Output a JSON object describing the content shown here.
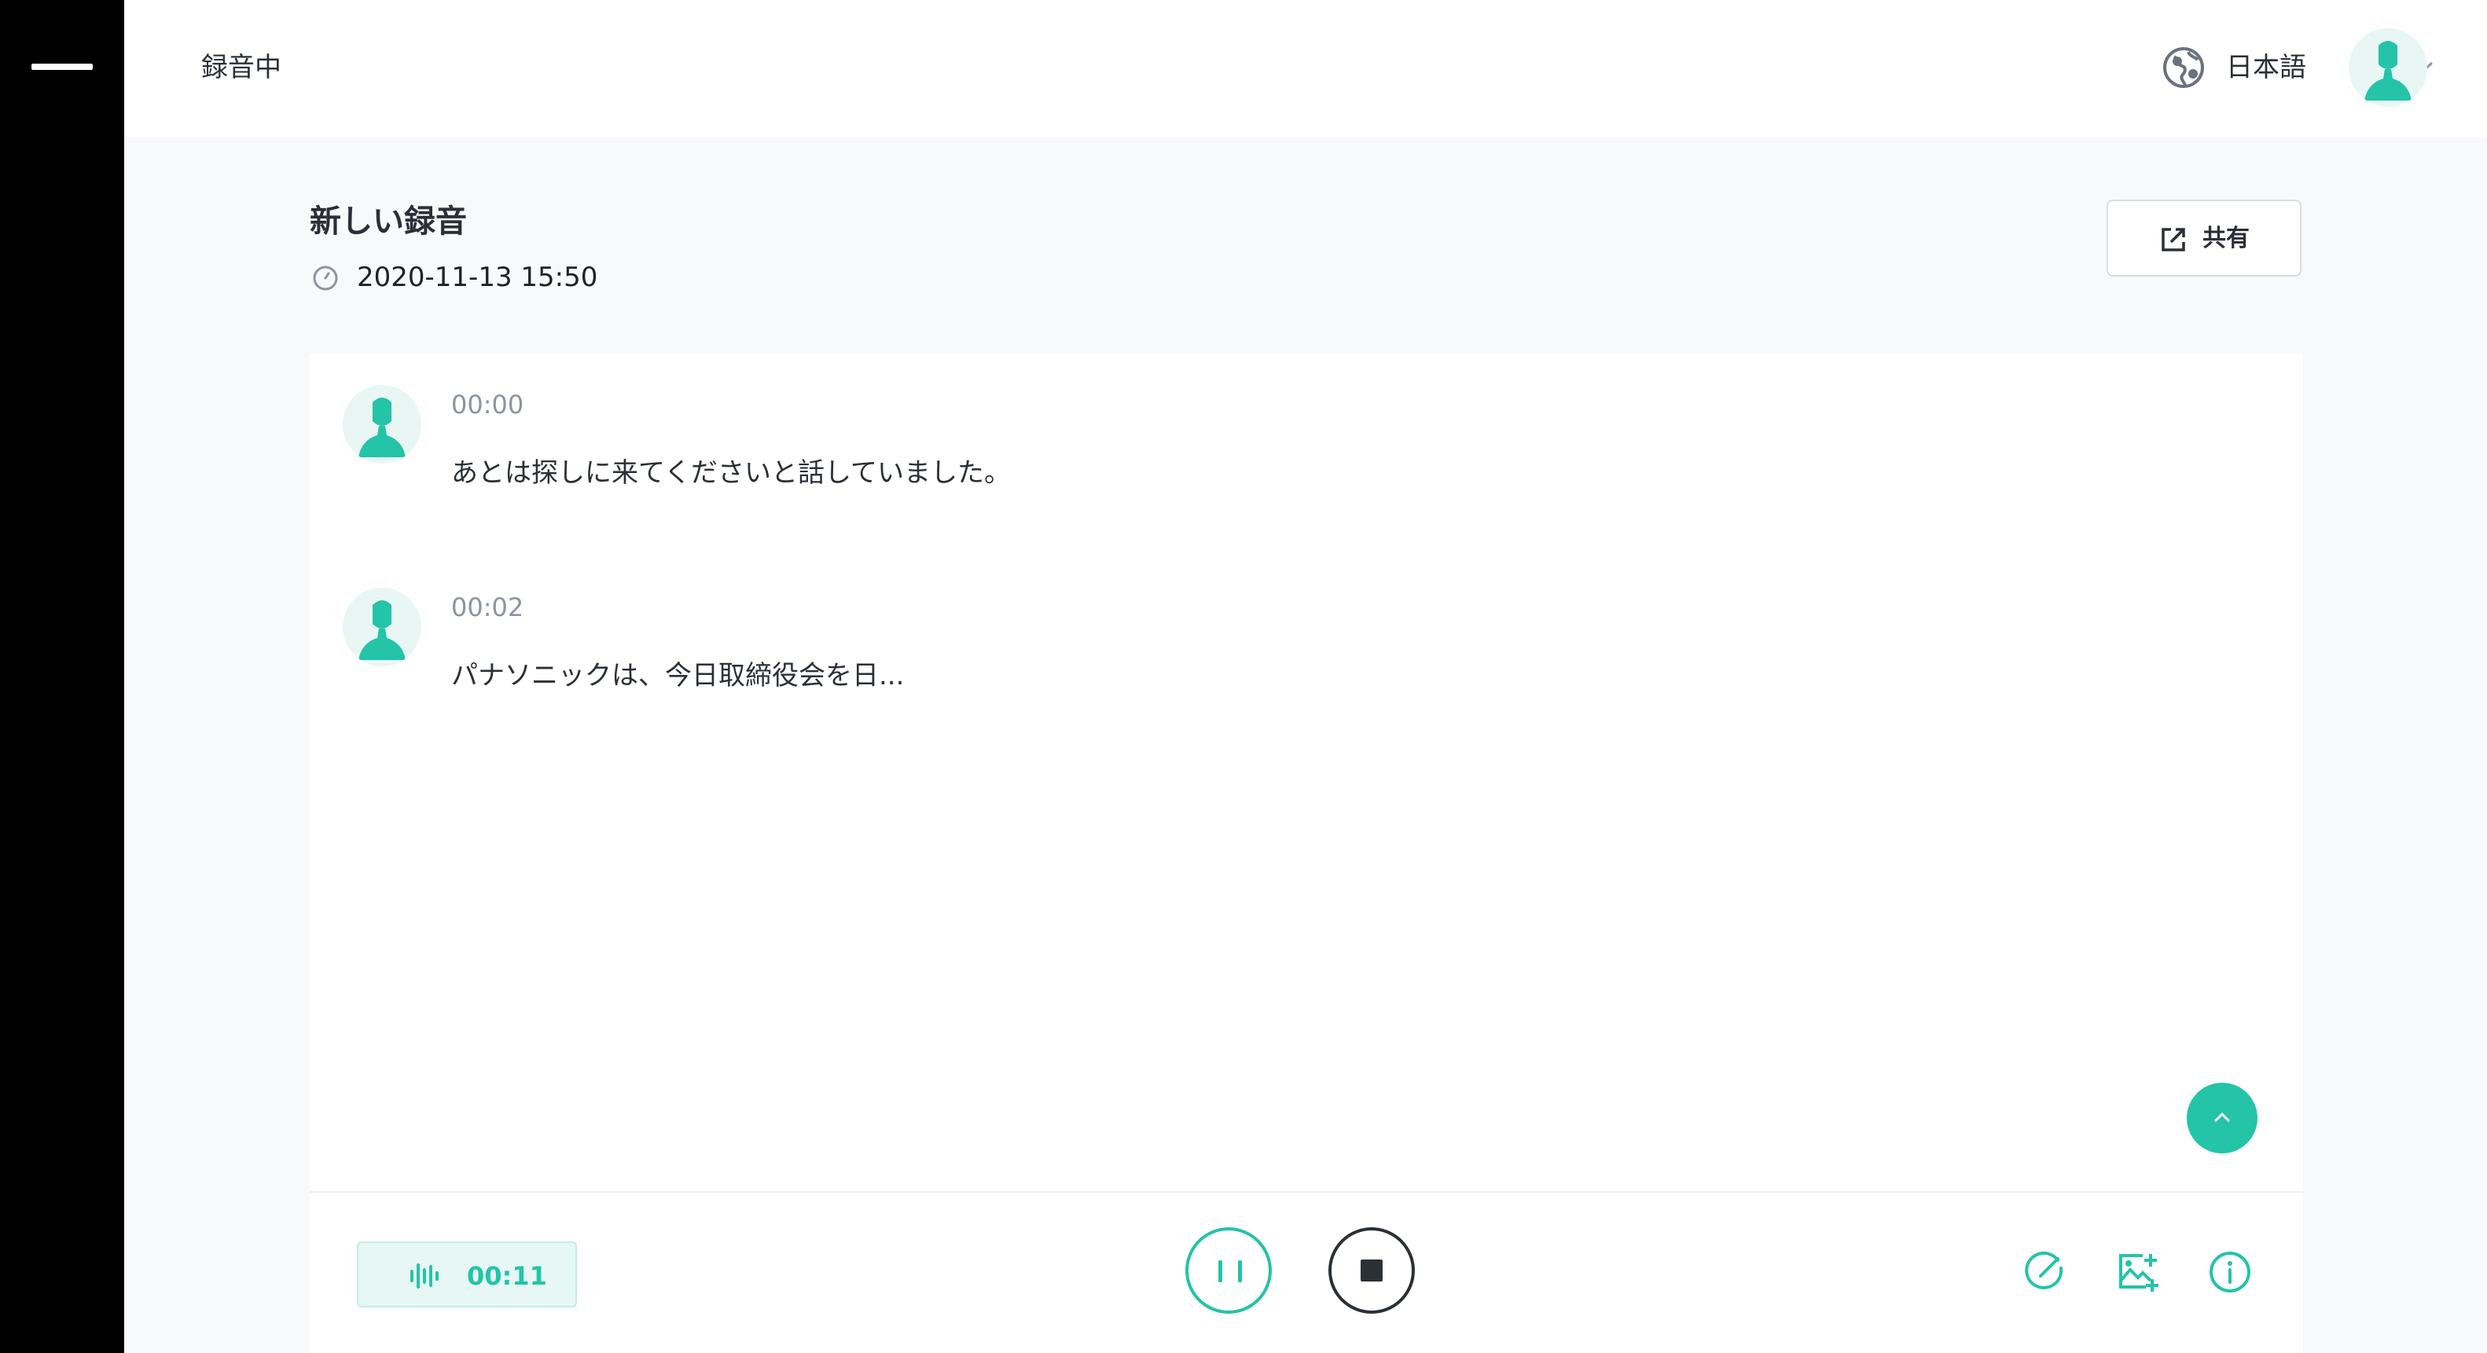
{
  "header": {
    "status": "録音中",
    "language": {
      "label": "日本語",
      "icon": "globe-icon"
    },
    "user_avatar": "user-avatar-icon"
  },
  "recording": {
    "title": "新しい録音",
    "datetime": "2020-11-13 15:50",
    "share_label": "共有"
  },
  "transcript": [
    {
      "time": "00:00",
      "text": "あとは探しに来てくださいと話していました。"
    },
    {
      "time": "00:02",
      "text": "パナソニックは、今日取締役会を日..."
    }
  ],
  "controls": {
    "elapsed": "00:11",
    "icons": [
      "audio-wave-icon",
      "pause-icon",
      "stop-icon",
      "edit-check-icon",
      "add-image-icon",
      "info-icon"
    ]
  },
  "colors": {
    "accent": "#23c4a8",
    "dark": "#2b2f36",
    "rail": "#000000"
  }
}
